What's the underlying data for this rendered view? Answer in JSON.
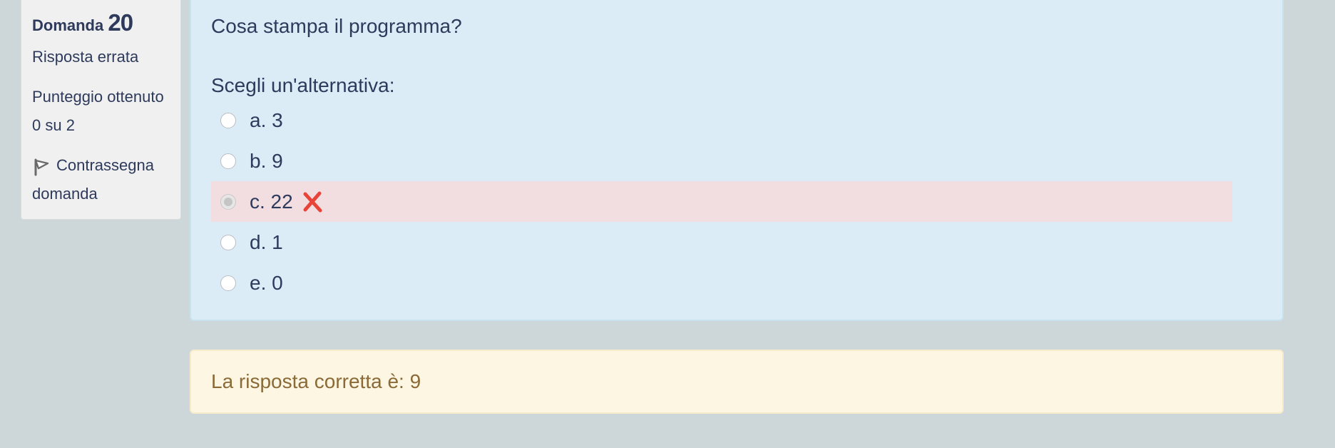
{
  "info": {
    "question_label": "Domanda",
    "question_number": "20",
    "state": "Risposta errata",
    "grade_line1": "Punteggio ottenuto",
    "grade_line2": "0 su 2",
    "flag_line1": "Contrassegna",
    "flag_line2": "domanda",
    "flag_icon": "flag-icon"
  },
  "question": {
    "text": "Cosa stampa il programma?",
    "prompt": "Scegli un'alternativa:",
    "options": [
      {
        "label": "a. 3",
        "selected": false,
        "incorrect": false
      },
      {
        "label": "b. 9",
        "selected": false,
        "incorrect": false
      },
      {
        "label": "c. 22",
        "selected": true,
        "incorrect": true,
        "marker_icon": "cross-icon"
      },
      {
        "label": "d. 1",
        "selected": false,
        "incorrect": false
      },
      {
        "label": "e. 0",
        "selected": false,
        "incorrect": false
      }
    ]
  },
  "feedback": {
    "right_answer": "La risposta corretta è: 9"
  },
  "colors": {
    "page_bg": "#cdd6d8",
    "question_bg": "#dbecf6",
    "incorrect_bg": "#f2dde0",
    "feedback_bg": "#fdf6e2",
    "cross": "#e8443a"
  }
}
